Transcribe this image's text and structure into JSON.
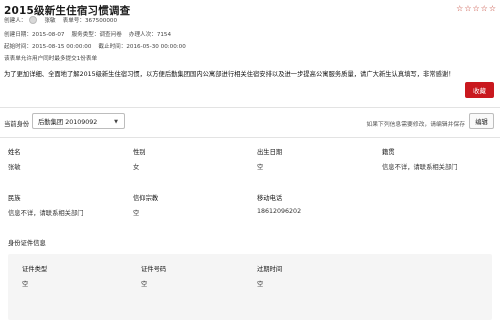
{
  "header": {
    "title": "2015级新生住宿习惯调查",
    "rating": 0,
    "stars": [
      "☆",
      "☆",
      "☆",
      "☆",
      "☆"
    ]
  },
  "meta": {
    "creator_label": "创建人：",
    "creator_name": "张敏",
    "table_no": "表单号：367500000",
    "create_date": "创建日期：2015-08-07",
    "service_type": "服务类型：调查问卷",
    "participants": "办理人次：7154",
    "start_time": "起始时间：2015-08-15 00:00:00",
    "end_time": "截止时间：2016-05-30 00:00:00",
    "limit_note": "该表单允许用户同时最多提交1份表单"
  },
  "notice": "为了更加详细、全面地了解2015级新生住宿习惯，以方便后勤集团国内公寓部进行相关住宿安排以及进一步提高公寓服务质量，请广大新生认真填写，非常感谢！",
  "collect_label": "收藏",
  "identity": {
    "label": "当前身份",
    "selected": "后勤集团 20109092"
  },
  "edit_hint": "如果下列信息需要修改，请编辑并保存",
  "edit_label": "编辑",
  "fields": {
    "name_label": "姓名",
    "name_value": "张敏",
    "gender_label": "性别",
    "gender_value": "女",
    "birth_label": "出生日期",
    "birth_value": "空",
    "origin_label": "籍贯",
    "origin_value": "信息不详，请联系相关部门",
    "ethnic_label": "民族",
    "ethnic_value": "信息不详，请联系相关部门",
    "religion_label": "信仰宗教",
    "religion_value": "空",
    "phone_label": "移动电话",
    "phone_value": "18612096202"
  },
  "id_section": {
    "title": "身份证件信息",
    "type_label": "证件类型",
    "type_value": "空",
    "number_label": "证件号码",
    "number_value": "空",
    "expire_label": "过期时间",
    "expire_value": "空"
  }
}
